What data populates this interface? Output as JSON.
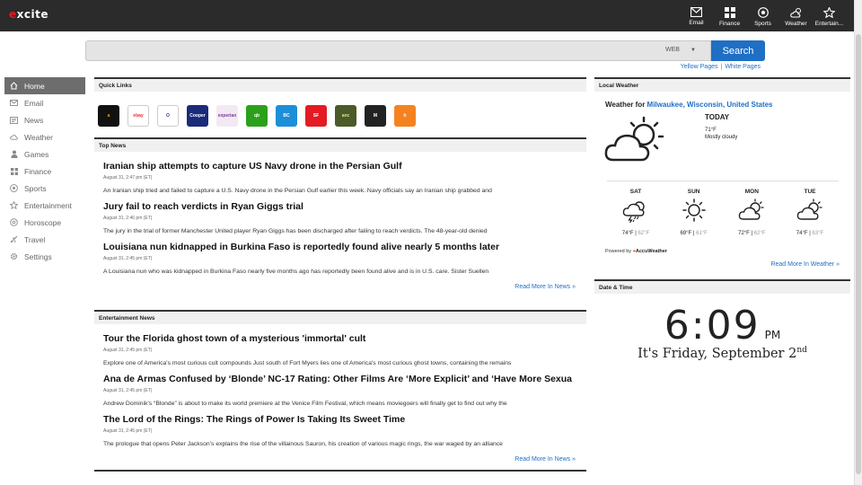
{
  "header": {
    "logo_text": "excite",
    "nav": [
      {
        "label": "Email",
        "icon": "email-icon"
      },
      {
        "label": "Finance",
        "icon": "finance-grid-icon"
      },
      {
        "label": "Sports",
        "icon": "soccer-ball-icon"
      },
      {
        "label": "Weather",
        "icon": "cloud-sun-icon"
      },
      {
        "label": "Entertain...",
        "icon": "star-icon"
      }
    ]
  },
  "search": {
    "placeholder": "",
    "type_selected": "WEB",
    "button_label": "Search",
    "yellow_pages": "Yellow Pages",
    "separator": "|",
    "white_pages": "White Pages"
  },
  "sidebar": {
    "items": [
      {
        "label": "Home",
        "icon": "home-icon"
      },
      {
        "label": "Email",
        "icon": "envelope-icon"
      },
      {
        "label": "News",
        "icon": "newspaper-icon"
      },
      {
        "label": "Weather",
        "icon": "cloud-icon"
      },
      {
        "label": "Games",
        "icon": "person-icon"
      },
      {
        "label": "Finance",
        "icon": "grid-icon"
      },
      {
        "label": "Sports",
        "icon": "ball-icon"
      },
      {
        "label": "Entertainment",
        "icon": "star-outline-icon"
      },
      {
        "label": "Horoscope",
        "icon": "horoscope-icon"
      },
      {
        "label": "Travel",
        "icon": "plane-icon"
      },
      {
        "label": "Settings",
        "icon": "gear-icon"
      }
    ]
  },
  "quick_links": {
    "title": "Quick Links",
    "items": [
      {
        "name": "amazon",
        "text": "a",
        "bg": "#111111",
        "fg": "#ff9900"
      },
      {
        "name": "ebay",
        "text": "ebay",
        "bg": "#ffffff",
        "fg": "#e53238"
      },
      {
        "name": "overstock",
        "text": "O",
        "bg": "#ffffff",
        "fg": "#3b3b8f"
      },
      {
        "name": "cooper",
        "text": "Cooper",
        "bg": "#1c2a7a",
        "fg": "#ffffff"
      },
      {
        "name": "experian",
        "text": "experian",
        "bg": "#f3e9f5",
        "fg": "#7b3f98"
      },
      {
        "name": "quickbooks",
        "text": "qb",
        "bg": "#2ca01c",
        "fg": "#ffffff"
      },
      {
        "name": "bluecross",
        "text": "BC",
        "bg": "#1d8fd8",
        "fg": "#ffffff"
      },
      {
        "name": "statefarm",
        "text": "SF",
        "bg": "#e31b23",
        "fg": "#ffffff"
      },
      {
        "name": "ancestry",
        "text": "anc",
        "bg": "#4a5a28",
        "fg": "#d7e28a"
      },
      {
        "name": "mercedes",
        "text": "M",
        "bg": "#222222",
        "fg": "#ffffff"
      },
      {
        "name": "hotels",
        "text": "h",
        "bg": "#f58220",
        "fg": "#ffffff"
      }
    ]
  },
  "top_news": {
    "title": "Top News",
    "read_more": "Read More In News",
    "articles": [
      {
        "headline": "Iranian ship attempts to capture US Navy drone in the Persian Gulf",
        "date": "August 31, 2:47 pm (ET)",
        "summary": "An Iranian ship tried and failed to capture a U.S. Navy drone in the Persian Gulf earlier this week. Navy officials say an Iranian ship grabbed and"
      },
      {
        "headline": "Jury fail to reach verdicts in Ryan Giggs trial",
        "date": "August 31, 2:46 pm (ET)",
        "summary": "The jury in the trial of former Manchester United player Ryan Giggs has been discharged after failing to reach verdicts. The 48-year-old denied"
      },
      {
        "headline": "Louisiana nun kidnapped in Burkina Faso is reportedly found alive nearly 5 months later",
        "date": "August 31, 2:45 pm (ET)",
        "summary": "A Louisiana nun who was kidnapped in Burkina Faso nearly five months ago has reportedly been found alive and is in U.S. care. Sister Suellen"
      }
    ]
  },
  "entertainment_news": {
    "title": "Entertainment News",
    "read_more": "Read More In News",
    "articles": [
      {
        "headline": "Tour the Florida ghost town of a mysterious 'immortal' cult",
        "date": "August 31, 2:45 pm (ET)",
        "summary": "Explore one of America's most curious cult compounds Just south of Fort Myers lies one of America's most curious ghost towns, containing the remains"
      },
      {
        "headline": "Ana de Armas Confused by ‘Blonde’ NC-17 Rating: Other Films Are ‘More Explicit’ and ‘Have More Sexua",
        "date": "August 31, 2:45 pm (ET)",
        "summary": "Andrew Dominik's “Blonde” is about to make its world premiere at the Venice Film Festival, which means moviegoers will finally get to find out why the"
      },
      {
        "headline": "The Lord of the Rings: The Rings of Power Is Taking Its Sweet Time",
        "date": "August 31, 2:45 pm (ET)",
        "summary": "The prologue that opens Peter Jackson’s explains the rise of the villainous Sauron, his creation of various magic rings, the war waged by an alliance"
      }
    ]
  },
  "weather": {
    "title": "Local Weather",
    "label": "Weather for",
    "location": "Milwaukee, Wisconsin, United States",
    "today_label": "TODAY",
    "today_temp": "71°F",
    "today_cond": "Mostly cloudy",
    "forecast": [
      {
        "day": "SAT",
        "hi": "74°F",
        "lo": "62°F",
        "icon": "thunderstorm-icon"
      },
      {
        "day": "SUN",
        "hi": "69°F",
        "lo": "61°F",
        "icon": "sun-icon"
      },
      {
        "day": "MON",
        "hi": "72°F",
        "lo": "62°F",
        "icon": "partly-cloudy-icon"
      },
      {
        "day": "TUE",
        "hi": "74°F",
        "lo": "63°F",
        "icon": "partly-cloudy-icon"
      }
    ],
    "temp_sep": "|",
    "powered_by": "Powered by",
    "provider": "AccuWeather",
    "read_more": "Read More In Weather"
  },
  "datetime": {
    "title": "Date & Time",
    "time": "6:09",
    "ampm": "PM",
    "date_text": "It's Friday, September 2",
    "date_suffix": "nd"
  },
  "colors": {
    "topbar": "#2b2b2b",
    "accent": "#1f6fc5",
    "active_sidebar": "#6d6d6d"
  }
}
